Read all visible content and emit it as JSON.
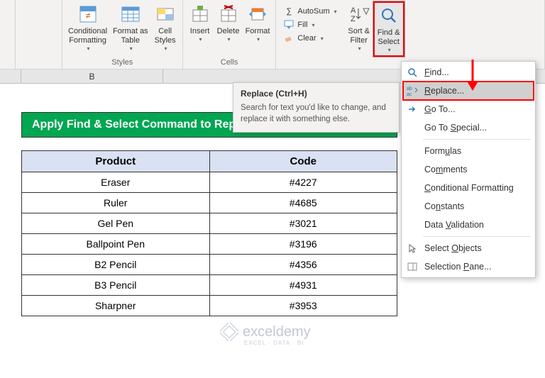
{
  "ribbon": {
    "conditional_formatting": "Conditional\nFormatting",
    "format_as_table": "Format as\nTable",
    "cell_styles": "Cell\nStyles",
    "styles_group": "Styles",
    "insert": "Insert",
    "delete": "Delete",
    "format": "Format",
    "cells_group": "Cells",
    "autosum": "AutoSum",
    "fill": "Fill",
    "clear": "Clear",
    "sort_filter": "Sort &\nFilter",
    "find_select": "Find &\nSelect"
  },
  "colheader": {
    "b": "B"
  },
  "banner": "Apply Find & Select Command to Replace Special Characte",
  "table": {
    "headers": {
      "product": "Product",
      "code": "Code"
    },
    "rows": [
      {
        "product": "Eraser",
        "code": "#4227"
      },
      {
        "product": "Ruler",
        "code": "#4685"
      },
      {
        "product": "Gel Pen",
        "code": "#3021"
      },
      {
        "product": "Ballpoint Pen",
        "code": "#3196"
      },
      {
        "product": "B2 Pencil",
        "code": "#4356"
      },
      {
        "product": "B3 Pencil",
        "code": "#4931"
      },
      {
        "product": "Sharpner",
        "code": "#3953"
      }
    ]
  },
  "tooltip": {
    "title": "Replace (Ctrl+H)",
    "body": "Search for text you'd like to change, and replace it with something else."
  },
  "menu": {
    "find": "Find...",
    "replace": "Replace...",
    "goto": "Go To...",
    "goto_special": "Go To Special...",
    "formulas": "Formulas",
    "comments": "Comments",
    "cond_fmt": "Conditional Formatting",
    "constants": "Constants",
    "data_validation": "Data Validation",
    "select_objects": "Select Objects",
    "selection_pane": "Selection Pane..."
  },
  "watermark": {
    "brand": "exceldemy",
    "sub": "EXCEL · DATA · BI"
  }
}
